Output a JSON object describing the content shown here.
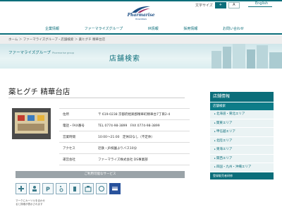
{
  "header": {
    "font_size_label": "文字サイズ",
    "font_size_options": [
      "+",
      "A"
    ],
    "english_label": "English",
    "logo_name": "Pharmarise",
    "logo_sub": "HOLDINGS"
  },
  "nav": {
    "items": [
      "企業情報",
      "ファーマライズグループ",
      "IR情報",
      "採用情報",
      "お問い合わせ"
    ]
  },
  "breadcrumb": "ホーム  ＞  ファーマライズグループ・店舗検索  ＞  薬ヒグチ 精華台店",
  "hero": {
    "group_label": "ファーマライズグループ",
    "group_label_en": "Pharmarise group",
    "title": "店舗検索"
  },
  "store": {
    "name": "薬ヒグチ 精華台店",
    "info": [
      {
        "label": "住所",
        "value": "〒 619-0238 京都府相楽郡精華町精華台7丁目2-4"
      },
      {
        "label": "電話・FAX番号",
        "value": "TEL 0774-98-3899　FAX 0774-98-3899"
      },
      {
        "label": "営業時間",
        "value": "10:00～21:00　定休日なし（不定休）"
      },
      {
        "label": "アクセス",
        "value": "近鉄・JR祝園よりバス10分"
      },
      {
        "label": "運営会社",
        "value": "ファーマライズ株式会社 DS事業部"
      }
    ]
  },
  "services": {
    "heading": "ご利用可能なサービス",
    "icons": [
      "pharmacy-icon",
      "counseling-icon",
      "parking-icon",
      "wheelchair-icon",
      "cosmetics-icon",
      "daily-goods-icon",
      "baby-icon",
      "card-icon"
    ],
    "note": "マークにカーソルを合わせると詳細が表示されます"
  },
  "sidebar": {
    "title": "店舗情報",
    "subtitle": "店舗検索",
    "items": [
      "北海道・東北エリア",
      "関東エリア",
      "甲信越エリア",
      "北陸エリア",
      "東海エリア",
      "関西エリア",
      "四国・九州・沖縄エリア"
    ],
    "footer": "登録販売者研修"
  },
  "colors": {
    "brand": "#0b6e7a",
    "card_icon": "#28529c"
  }
}
